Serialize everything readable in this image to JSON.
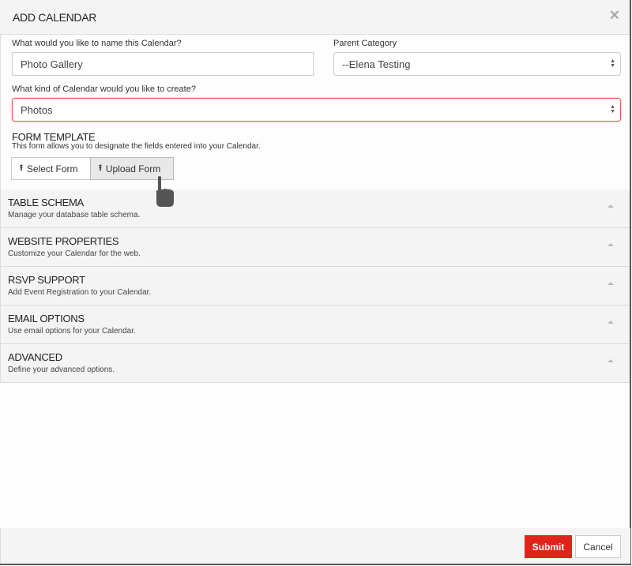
{
  "modal": {
    "title": "ADD CALENDAR",
    "close_icon": "close-icon"
  },
  "form": {
    "name_label": "What would you like to name this Calendar?",
    "name_value": "Photo Gallery",
    "parent_label": "Parent Category",
    "parent_value": "--Elena Testing",
    "kind_label": "What kind of Calendar would you like to create?",
    "kind_value": "Photos",
    "kind_error_color": "#e05a5a"
  },
  "form_template": {
    "title": "FORM TEMPLATE",
    "description": "This form allows you to designate the fields entered into your Calendar.",
    "buttons": [
      {
        "label": "Select Form",
        "icon": "upload-icon",
        "active": false
      },
      {
        "label": "Upload Form",
        "icon": "upload-icon",
        "active": true
      }
    ]
  },
  "panels": [
    {
      "title": "TABLE SCHEMA",
      "description": "Manage your database table schema."
    },
    {
      "title": "WEBSITE PROPERTIES",
      "description": "Customize your Calendar for the web."
    },
    {
      "title": "RSVP SUPPORT",
      "description": "Add Event Registration to your Calendar."
    },
    {
      "title": "EMAIL OPTIONS",
      "description": "Use email options for your Calendar."
    },
    {
      "title": "ADVANCED",
      "description": "Define your advanced options."
    }
  ],
  "footer": {
    "submit_label": "Submit",
    "cancel_label": "Cancel",
    "submit_color": "#e0241b"
  }
}
